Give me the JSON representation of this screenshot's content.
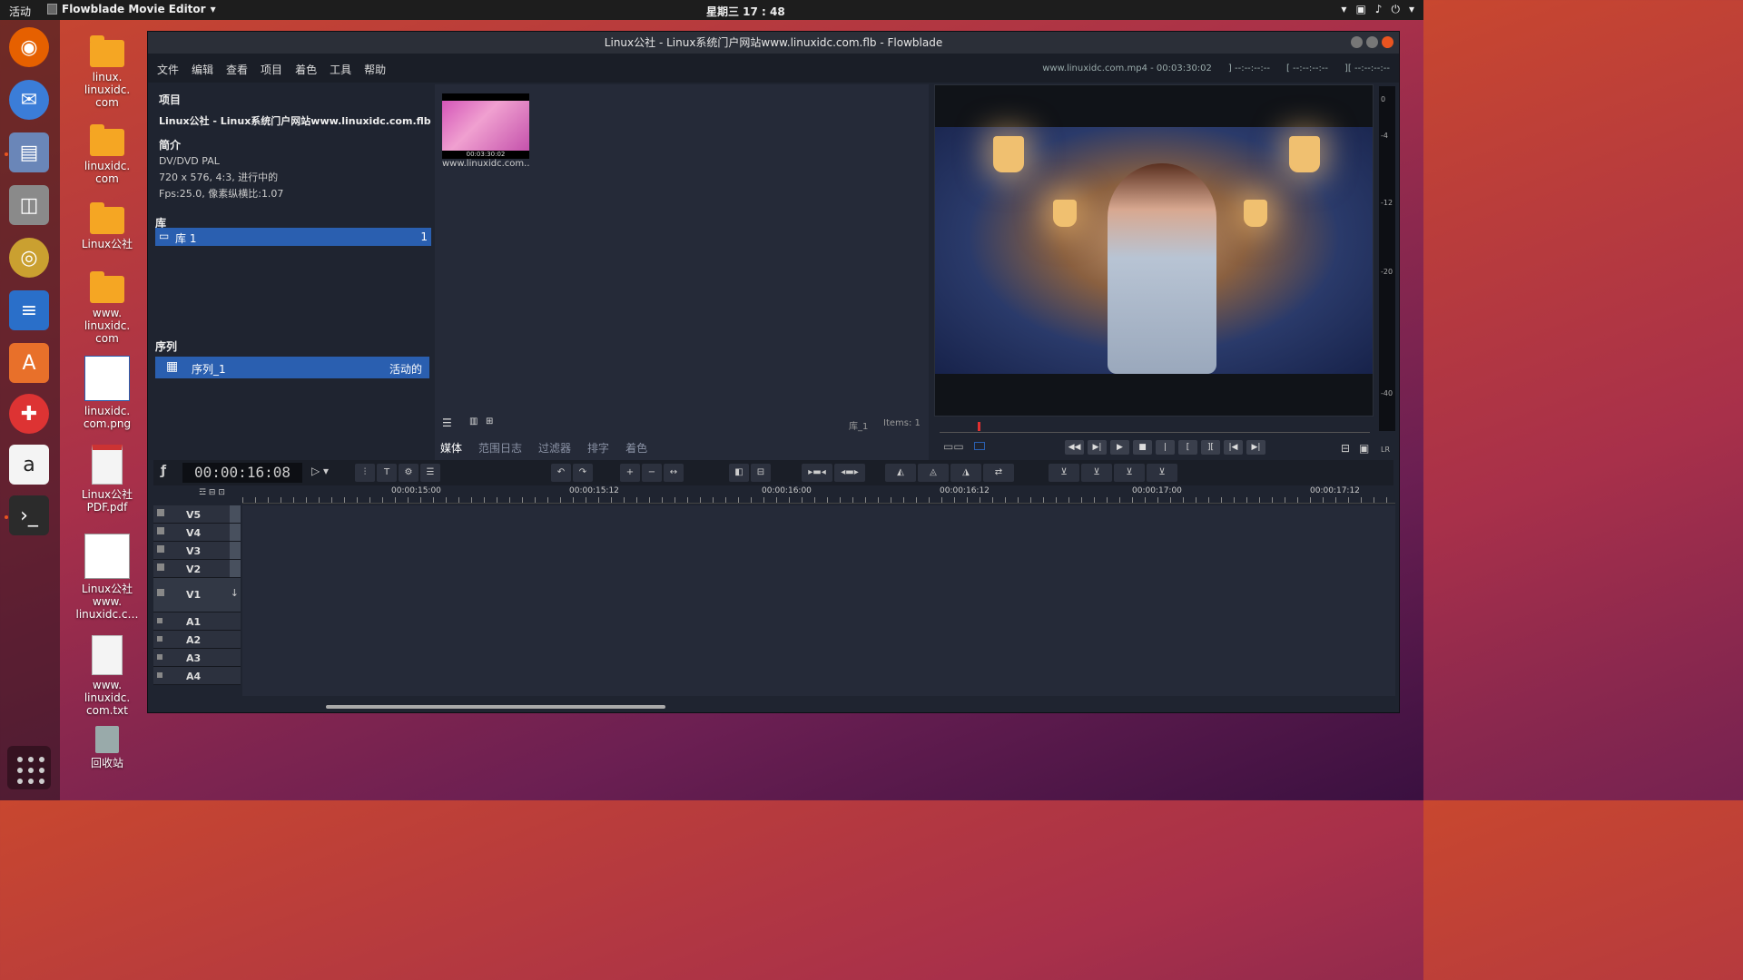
{
  "topbar": {
    "activities": "活动",
    "app_name": "Flowblade Movie Editor",
    "clock": "星期三 17 : 48"
  },
  "dock": {
    "items": [
      "firefox-icon",
      "thunderbird-icon",
      "files-icon",
      "screenshot-icon",
      "rhythmbox-icon",
      "writer-icon",
      "software-icon",
      "help-icon",
      "amazon-icon",
      "terminal-icon"
    ]
  },
  "desktop": {
    "icons": [
      {
        "label": "linux.\nlinuxidc.\ncom",
        "kind": "folder"
      },
      {
        "label": "linuxidc.\ncom",
        "kind": "folder"
      },
      {
        "label": "Linux公社",
        "kind": "folder"
      },
      {
        "label": "www.\nlinuxidc.\ncom",
        "kind": "folder"
      },
      {
        "label": "linuxidc.\ncom.png",
        "kind": "image"
      },
      {
        "label": "Linux公社\nPDF.pdf",
        "kind": "pdf"
      },
      {
        "label": "Linux公社\nwww.\nlinuxidc.c…",
        "kind": "image"
      },
      {
        "label": "www.\nlinuxidc.\ncom.txt",
        "kind": "text"
      },
      {
        "label": "回收站",
        "kind": "trash"
      }
    ]
  },
  "window": {
    "title": "Linux公社 - Linux系统门户网站www.linuxidc.com.flb - Flowblade",
    "menus": [
      "文件",
      "编辑",
      "查看",
      "项目",
      "着色",
      "工具",
      "帮助"
    ],
    "clip_info": "www.linuxidc.com.mp4 - 00:03:30:02",
    "mark_in": "] --:--:--:--",
    "mark_out": "[ --:--:--:--",
    "length": "][ --:--:--:--"
  },
  "project": {
    "section_project": "项目",
    "project_name": "Linux公社 - Linux系统门户网站www.linuxidc.com.flb",
    "section_profile": "简介",
    "profile_name": "DV/DVD PAL",
    "profile_line1": "720 x 576, 4:3, 进行中的",
    "profile_line2": "Fps:25.0, 像素纵横比:1.07",
    "section_bins": "库",
    "bin_name": "库 1",
    "bin_count": "1",
    "section_sequences": "序列",
    "sequence_name": "序列_1",
    "sequence_status": "活动的"
  },
  "media": {
    "thumb_timecode": "00:03:30:02",
    "thumb_label": "www.linuxidc.com.…",
    "bin_label": "库_1",
    "items_label": "Items: 1",
    "tabs": [
      "媒体",
      "范围日志",
      "过滤器",
      "排字",
      "着色"
    ],
    "active_tab": "媒体"
  },
  "meter": {
    "labels": [
      "0",
      "-4",
      "-12",
      "-20",
      "-40"
    ],
    "lr": "LR"
  },
  "timeline": {
    "timecode": "00:00:16:08",
    "ruler_labels": [
      "00:00:15:00",
      "00:00:15:12",
      "00:00:16:00",
      "00:00:16:12",
      "00:00:17:00",
      "00:00:17:12"
    ],
    "tracks": [
      "V5",
      "V4",
      "V3",
      "V2",
      "V1",
      "A1",
      "A2",
      "A3",
      "A4"
    ]
  },
  "colors": {
    "accent": "#e95420",
    "selection": "#2a5fb0",
    "panel_bg": "#1f2430"
  }
}
